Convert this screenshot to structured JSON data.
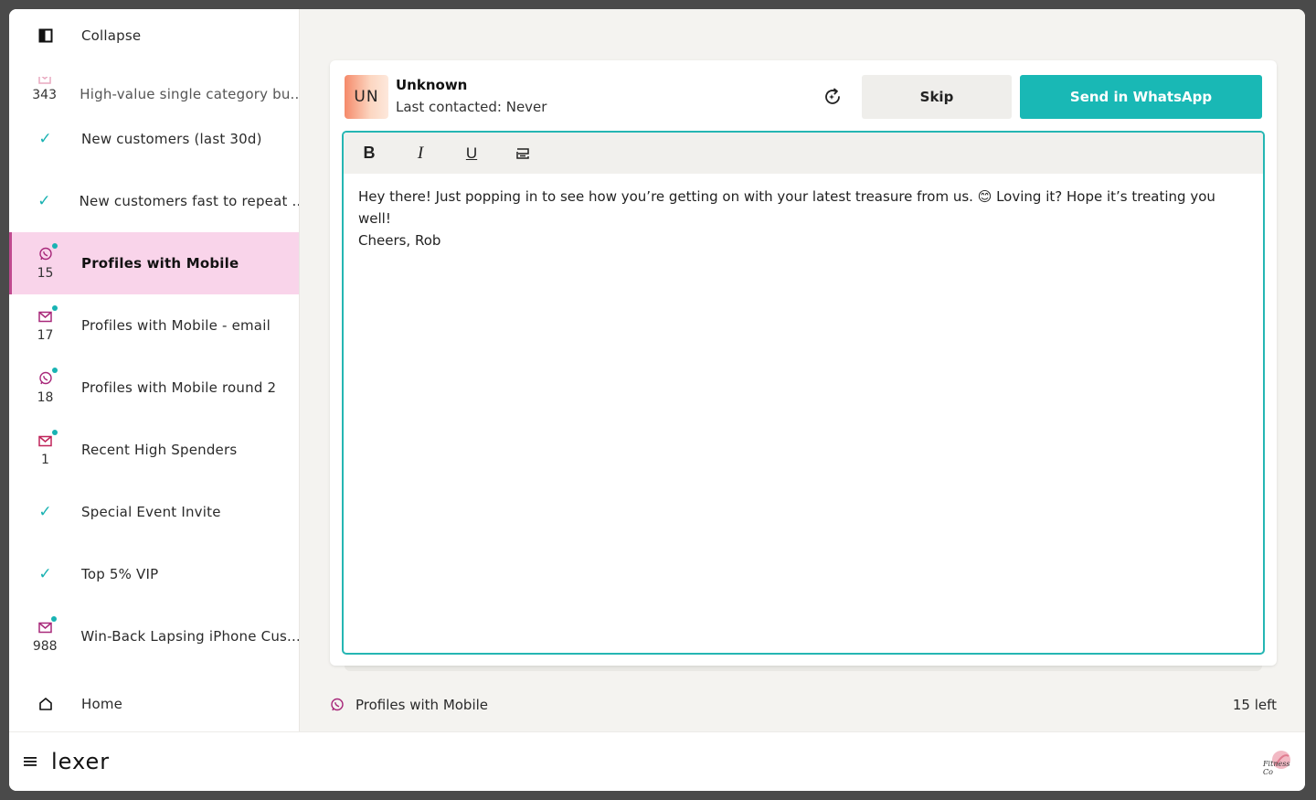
{
  "sidebar": {
    "collapse_label": "Collapse",
    "items": [
      {
        "label": "High-value single category bu...",
        "count": "343",
        "icon": "mail-icon",
        "state": "faded"
      },
      {
        "label": "New customers (last 30d)",
        "count": "",
        "icon": "check-icon",
        "state": "done"
      },
      {
        "label": "New customers fast to repeat ...",
        "count": "",
        "icon": "check-icon",
        "state": "done"
      },
      {
        "label": "Profiles with Mobile",
        "count": "15",
        "icon": "whatsapp-icon",
        "state": "active"
      },
      {
        "label": "Profiles with Mobile - email",
        "count": "17",
        "icon": "mail-icon",
        "state": "pending"
      },
      {
        "label": "Profiles with Mobile round 2",
        "count": "18",
        "icon": "whatsapp-icon",
        "state": "pending"
      },
      {
        "label": "Recent High Spenders",
        "count": "1",
        "icon": "mail-icon",
        "state": "pending"
      },
      {
        "label": "Special Event Invite",
        "count": "",
        "icon": "check-icon",
        "state": "done"
      },
      {
        "label": "Top 5% VIP",
        "count": "",
        "icon": "check-icon",
        "state": "done"
      },
      {
        "label": "Win-Back Lapsing iPhone Cus...",
        "count": "988",
        "icon": "mail-icon",
        "state": "pending"
      }
    ],
    "home_label": "Home",
    "check_glyph": "✓"
  },
  "contact": {
    "initials": "UN",
    "name": "Unknown",
    "last_contacted": "Last contacted: Never"
  },
  "actions": {
    "skip_label": "Skip",
    "send_label": "Send in WhatsApp"
  },
  "editor": {
    "toolbar": {
      "bold": "B",
      "italic": "I",
      "underline": "U"
    },
    "message": "Hey there! Just popping in to see how you’re getting on with your latest treasure from us. 😊 Loving it? Hope it’s treating you well!\nCheers, Rob"
  },
  "footer": {
    "segment_label": "Profiles with Mobile",
    "remaining": "15 left"
  },
  "brand": {
    "logo_text": "lexer",
    "org_logo_text": "Fitness Co"
  },
  "colors": {
    "accent": "#19b8b5",
    "active_bg": "#f9d4ea",
    "mail": "#c0245a",
    "whatsapp": "#a8287a",
    "status_dot": "#18b3b3"
  }
}
